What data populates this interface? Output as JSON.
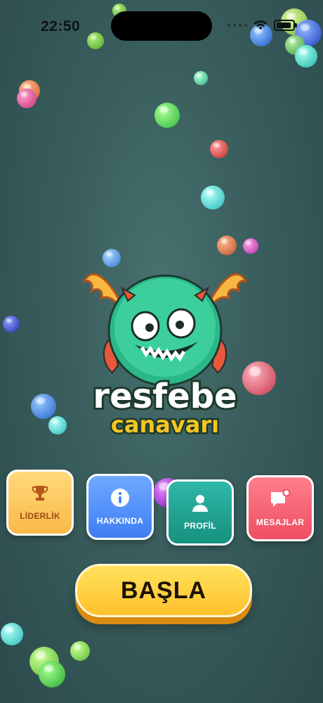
{
  "status_bar": {
    "time": "22:50"
  },
  "logo": {
    "line1": "resfebe",
    "line2": "canavarı"
  },
  "menu": {
    "leaderboard": {
      "label": "LİDERLİK",
      "icon": "trophy-icon"
    },
    "about": {
      "label": "HAKKINDA",
      "icon": "info-icon"
    },
    "profile": {
      "label": "PROFİL",
      "icon": "user-icon"
    },
    "messages": {
      "label": "MESAJLAR",
      "icon": "chat-icon"
    }
  },
  "start": {
    "label": "BAŞLA"
  },
  "colors": {
    "background": "#3a5f5e",
    "leaderboard": "#f9b947",
    "about": "#3f7ef4",
    "profile": "#16917f",
    "messages": "#ef4e63",
    "start": "#ffc12d"
  }
}
